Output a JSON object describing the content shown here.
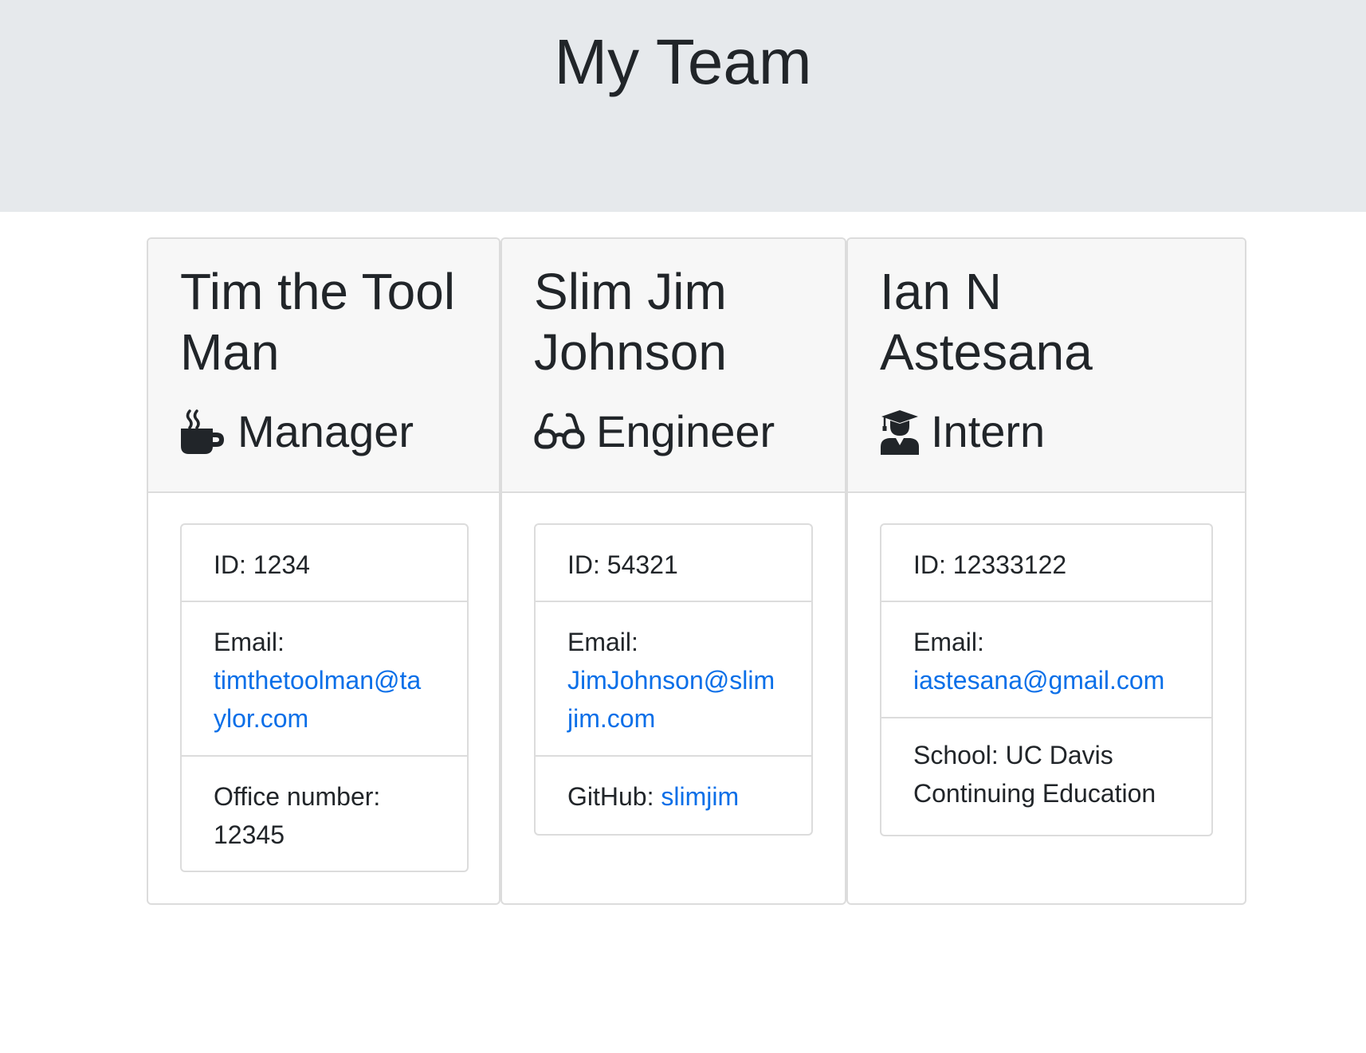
{
  "header": {
    "title": "My Team"
  },
  "colors": {
    "header_background": "#e6e9ec",
    "card_header_background": "#f7f7f7",
    "link": "#0a6fe8",
    "text": "#212529"
  },
  "cards": [
    {
      "name_line1": "Tim the Tool",
      "name_line2": "Man",
      "role": "Manager",
      "role_icon": "coffee-mug-icon",
      "id_text": "ID: 1234",
      "email_label": "Email:",
      "email_line1": "timthetoolman@ta",
      "email_line2": "ylor.com",
      "extra_label": "Office number:",
      "extra_value": "12345"
    },
    {
      "name_line1": "Slim Jim",
      "name_line2": "Johnson",
      "role": "Engineer",
      "role_icon": "glasses-icon",
      "id_text": "ID: 54321",
      "email_label": "Email:",
      "email_line1": "JimJohnson@slim",
      "email_line2": "jim.com",
      "extra_label": "GitHub: ",
      "extra_value": "slimjim"
    },
    {
      "name_line1": "Ian N",
      "name_line2": "Astesana",
      "role": "Intern",
      "role_icon": "graduate-icon",
      "id_text": "ID: 12333122",
      "email_label": "Email:",
      "email_line1": "iastesana@gmail.com",
      "extra_label": "School: UC Davis",
      "extra_value": "Continuing Education"
    }
  ]
}
